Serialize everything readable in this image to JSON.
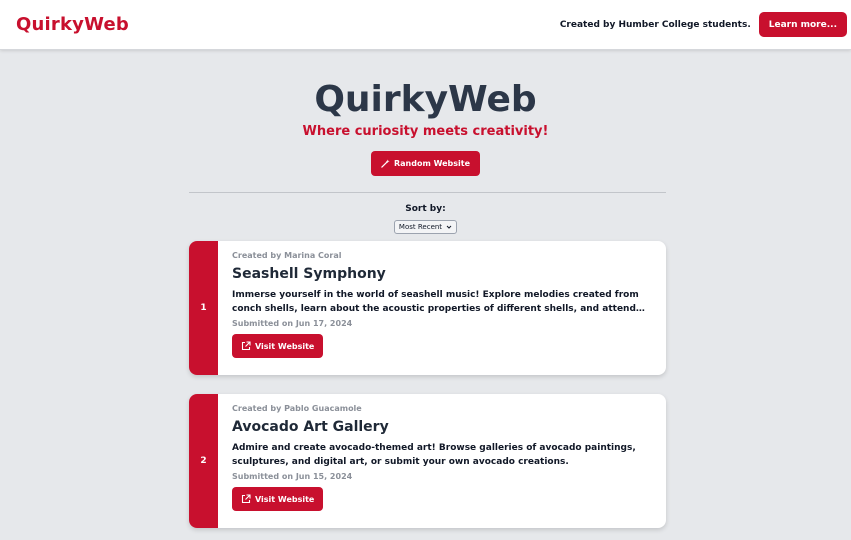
{
  "header": {
    "logo": "QuirkyWeb",
    "credit": "Created by Humber College students.",
    "learn_more_label": "Learn more..."
  },
  "hero": {
    "title": "QuirkyWeb",
    "tagline": "Where curiosity meets creativity!",
    "random_label": "Random Website"
  },
  "sort": {
    "label": "Sort by:",
    "selected": "Most Recent"
  },
  "cards": [
    {
      "index": "1",
      "creator": "Created by Marina Coral",
      "title": "Seashell Symphony",
      "description": "Immerse yourself in the world of seashell music! Explore melodies created from conch shells, learn about the acoustic properties of different shells, and attend virtual...",
      "submitted": "Submitted on Jun 17, 2024",
      "visit_label": "Visit Website"
    },
    {
      "index": "2",
      "creator": "Created by Pablo Guacamole",
      "title": "Avocado Art Gallery",
      "description": "Admire and create avocado-themed art! Browse galleries of avocado paintings, sculptures, and digital art, or submit your own avocado creations.",
      "submitted": "Submitted on Jun 15, 2024",
      "visit_label": "Visit Website"
    }
  ],
  "colors": {
    "accent": "#c8102e",
    "background": "#e6e8eb",
    "title": "#2c3748"
  }
}
